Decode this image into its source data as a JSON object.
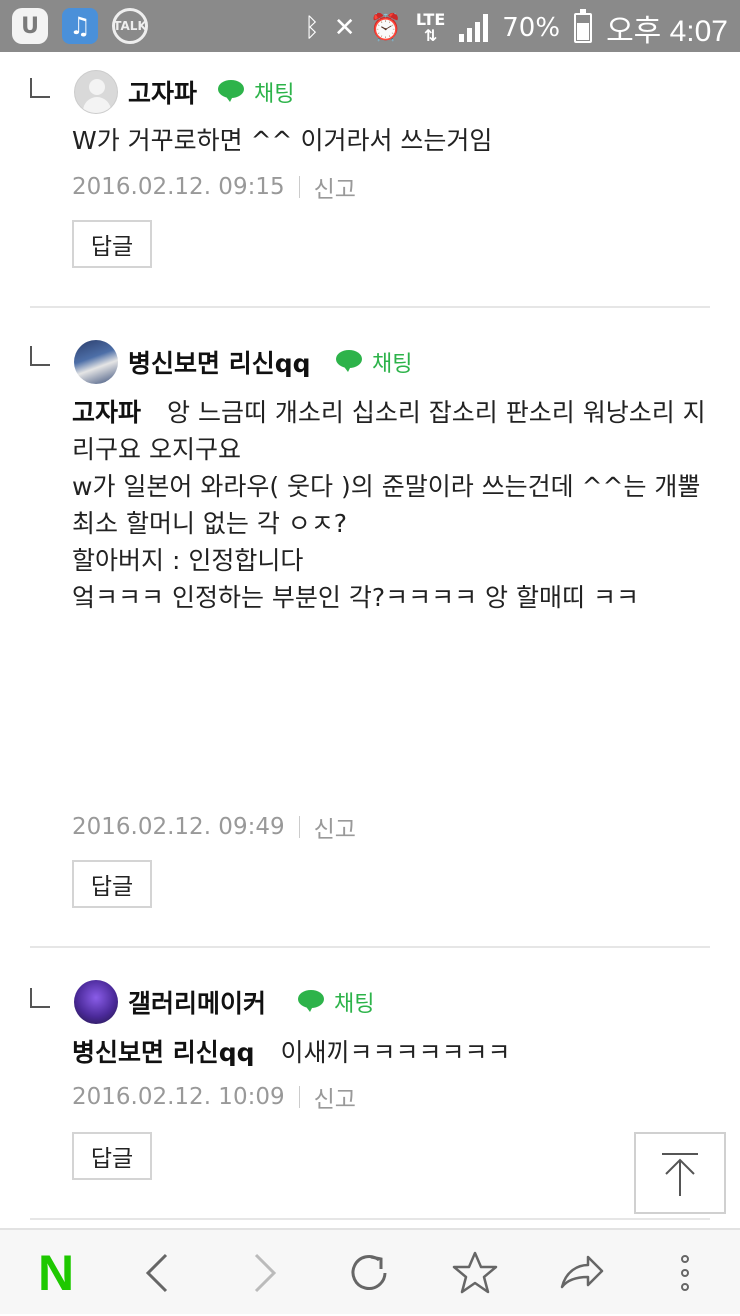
{
  "status_bar": {
    "left_icons": [
      "u-plus-icon",
      "music-icon",
      "talk-icon"
    ],
    "talk_label": "TALK",
    "u_label": "U",
    "lte": "LTE",
    "battery_percent": "70%",
    "battery_level": 0.7,
    "time": "오후 4:07"
  },
  "chat_label": "채팅",
  "comments": [
    {
      "username": "고자파",
      "mention": "",
      "lines": [
        "W가 거꾸로하면 ^^ 이거라서 쓰는거임"
      ],
      "date": "2016.02.12. 09:15",
      "report": "신고",
      "reply": "답글"
    },
    {
      "username": "병신보면 리신qq",
      "mention": "고자파",
      "lines": [
        "앙 느금띠 개소리 십소리 잡소리 판소리 워낭소리 지리구요 오지구요",
        "",
        "w가 일본어 와라우( 웃다 )의 준말이라 쓰는건데 ^^는 개뿔",
        "",
        "최소 할머니 없는 각 ㅇㅈ?",
        "",
        "할아버지 : 인정합니다",
        "",
        "엌ㅋㅋㅋ 인정하는 부분인 각?ㅋㅋㅋㅋ 앙 할매띠 ㅋㅋ"
      ],
      "date": "2016.02.12. 09:49",
      "report": "신고",
      "reply": "답글"
    },
    {
      "username": "갤러리메이커",
      "mention": "병신보면 리신qq",
      "lines": [
        "이새끼ㅋㅋㅋㅋㅋㅋㅋ"
      ],
      "date": "2016.02.12. 10:09",
      "report": "신고",
      "reply": "답글"
    }
  ],
  "bottom_nav": {
    "logo": "N",
    "icons": [
      "back-icon",
      "forward-icon",
      "refresh-icon",
      "bookmark-star-icon",
      "share-icon",
      "more-icon"
    ]
  },
  "colors": {
    "naver_green": "#1ec800",
    "chat_green": "#2db34a",
    "status_bar": "#8a8a8a"
  }
}
